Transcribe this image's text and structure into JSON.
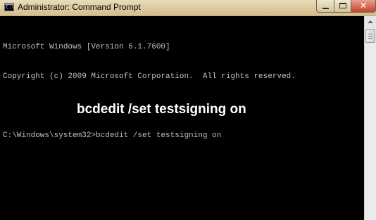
{
  "window": {
    "title": "Administrator: Command Prompt",
    "icon": "cmd-icon",
    "controls": {
      "minimize_icon": "minimize-icon",
      "maximize_icon": "maximize-icon",
      "close_glyph": "✕"
    }
  },
  "console": {
    "lines": [
      "Microsoft Windows [Version 6.1.7600]",
      "Copyright (c) 2009 Microsoft Corporation.  All rights reserved.",
      "",
      "C:\\Windows\\system32>bcdedit /set testsigning on"
    ],
    "prompt_glyph": "C:\\"
  },
  "overlay": {
    "caption": "bcdedit /set testsigning on"
  },
  "colors": {
    "console_bg": "#000000",
    "console_text": "#c0c0c0",
    "titlebar": "#dcc99d",
    "close_button": "#c7432b",
    "caption_text": "#ffffff"
  }
}
